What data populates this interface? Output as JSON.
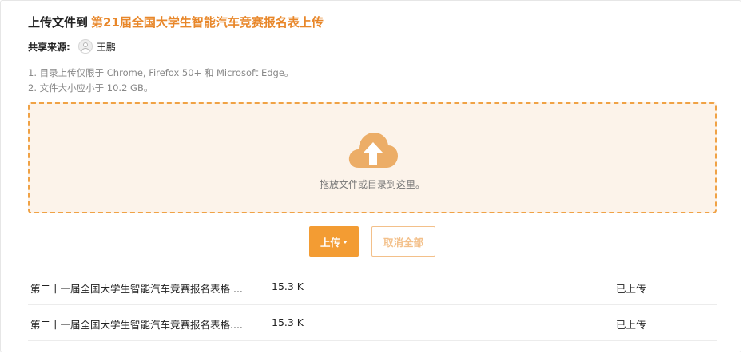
{
  "header": {
    "title_prefix": "上传文件到",
    "target_name": "第21届全国大学生智能汽车竞赛报名表上传"
  },
  "share": {
    "label": "共享来源:",
    "user_name": "王鹏"
  },
  "notes": [
    "1. 目录上传仅限于 Chrome, Firefox 50+ 和 Microsoft Edge。",
    "2. 文件大小应小于 10.2 GB。"
  ],
  "dropzone": {
    "text": "拖放文件或目录到这里。",
    "icon": "cloud-upload-icon"
  },
  "buttons": {
    "upload_label": "上传",
    "cancel_all_label": "取消全部"
  },
  "files": [
    {
      "name": "第二十一届全国大学生智能汽车竞赛报名表格 ...",
      "size": "15.3 K",
      "status": "已上传"
    },
    {
      "name": "第二十一届全国大学生智能汽车竞赛报名表格....",
      "size": "15.3 K",
      "status": "已上传"
    }
  ],
  "colors": {
    "accent": "#f39c33",
    "title_accent": "#e8872a",
    "dropzone_border": "#f0a245",
    "dropzone_bg": "#fcf3ea",
    "cloud_icon": "#ecad67"
  }
}
